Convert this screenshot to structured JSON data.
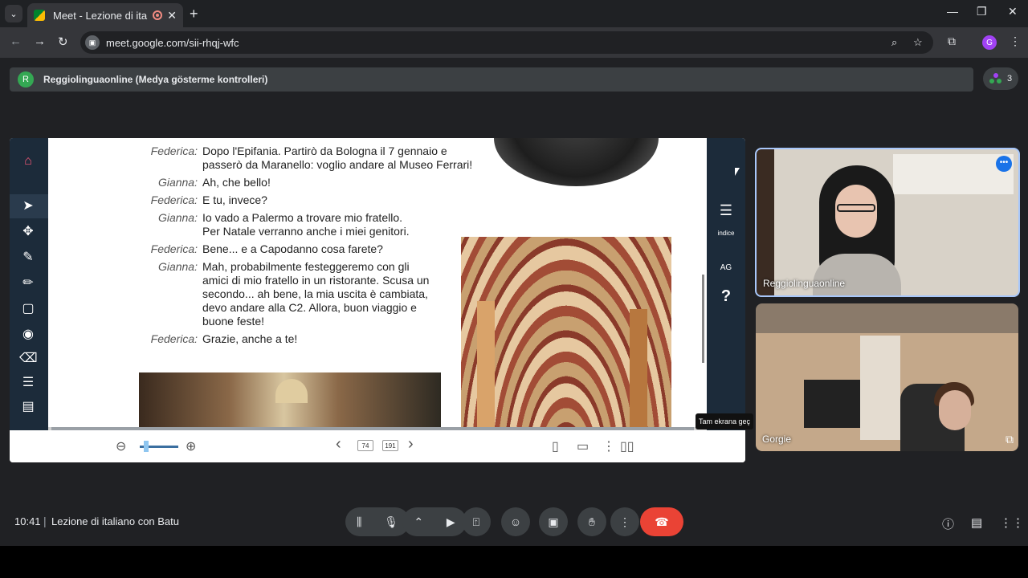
{
  "browser": {
    "tab_title": "Meet - Lezione di italiano c",
    "new_tab": "+",
    "tab_close": "✕",
    "url": "meet.google.com/sii-rhqj-wfc",
    "profile_initial": "G",
    "window": {
      "minimize": "—",
      "maximize": "❐",
      "close": "✕"
    }
  },
  "banner": {
    "avatar_initial": "R",
    "text": "Reggiolinguaonline (Medya gösterme kontrolleri)"
  },
  "participants_count": "3",
  "presentation": {
    "dialog": [
      {
        "speaker": "Federica:",
        "lines": [
          "Dopo l'Epifania. Partirò da Bologna il 7 gennaio e",
          "passerò da Maranello: voglio andare al Museo Ferrari!"
        ]
      },
      {
        "speaker": "Gianna:",
        "lines": [
          "Ah, che bello!"
        ]
      },
      {
        "speaker": "Federica:",
        "lines": [
          "E tu, invece?"
        ]
      },
      {
        "speaker": "Gianna:",
        "lines": [
          "Io vado a Palermo a trovare mio fratello.",
          "Per Natale verranno anche i miei genitori."
        ]
      },
      {
        "speaker": "Federica:",
        "lines": [
          "Bene... e a Capodanno cosa farete?"
        ]
      },
      {
        "speaker": "Gianna:",
        "lines": [
          "Mah, probabilmente festeggeremo con gli",
          "amici di mio fratello in un ristorante. Scusa un",
          "secondo... ah bene, la mia uscita è cambiata,",
          "devo andare alla C2. Allora, buon viaggio e",
          "buone feste!"
        ]
      },
      {
        "speaker": "Federica:",
        "lines": [
          "Grazie, anche a te!"
        ]
      }
    ],
    "right_tools": {
      "indice": "indice",
      "ag": "AG",
      "help": "?"
    },
    "current_page": "74",
    "total_pages": "191"
  },
  "tooltip": "Tam ekrana geç",
  "tiles": [
    {
      "name": "Reggiolinguaonline",
      "more": "•••"
    },
    {
      "name": "Gorgie"
    }
  ],
  "bottom": {
    "time": "10:41",
    "separator": "|",
    "meeting_name": "Lezione di italiano con Batu"
  }
}
